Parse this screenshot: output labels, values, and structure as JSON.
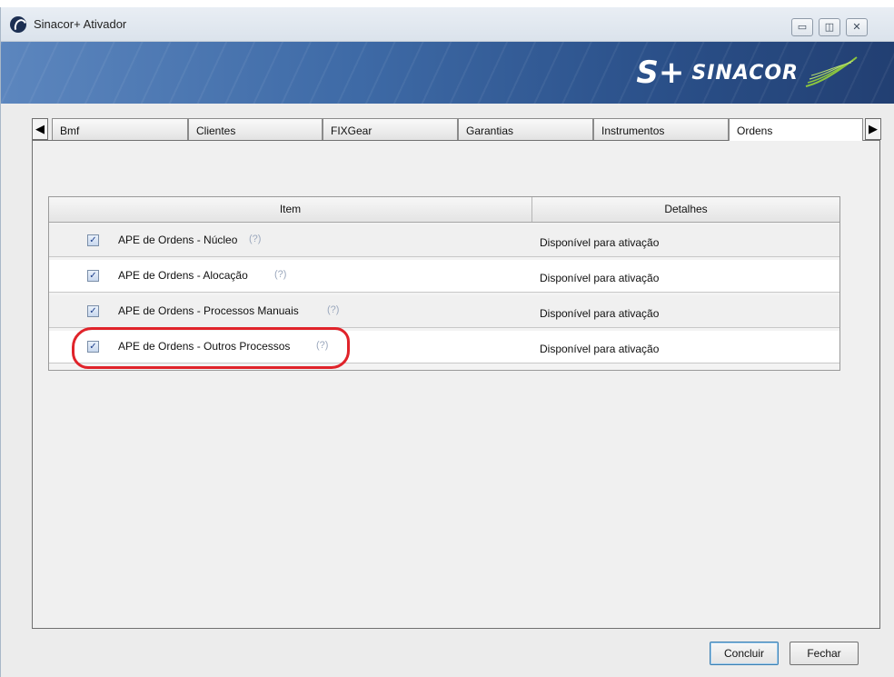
{
  "window": {
    "title": "Sinacor+ Ativador",
    "controls": {
      "minimize": "▭",
      "restore": "◫",
      "close": "✕"
    }
  },
  "banner": {
    "logo_mark": "S+",
    "logo_text": "SINACOR"
  },
  "tabs": {
    "scroll_left": "◀",
    "scroll_right": "▶",
    "items": [
      {
        "label": "Bmf"
      },
      {
        "label": "Clientes"
      },
      {
        "label": "FIXGear"
      },
      {
        "label": "Garantias"
      },
      {
        "label": "Instrumentos"
      },
      {
        "label": "Ordens"
      }
    ],
    "active": "Ordens"
  },
  "grid": {
    "columns": {
      "item": "Item",
      "details": "Detalhes"
    },
    "help_glyph": "(?)",
    "check_glyph": "✓",
    "rows": [
      {
        "label": "APE de Ordens - Núcleo",
        "checked": true,
        "details": "Disponível para ativação"
      },
      {
        "label": "APE de Ordens - Alocação",
        "checked": true,
        "details": "Disponível para ativação"
      },
      {
        "label": "APE de Ordens - Processos Manuais",
        "checked": true,
        "details": "Disponível para ativação"
      },
      {
        "label": "APE de Ordens - Outros Processos",
        "checked": true,
        "details": "Disponível para ativação"
      }
    ]
  },
  "buttons": {
    "finish": "Concluir",
    "close": "Fechar"
  },
  "colors": {
    "highlight": "#e0232a",
    "banner_dark": "#223f72",
    "banner_light": "#5c86be",
    "logo_accent": "#8cc63f"
  }
}
